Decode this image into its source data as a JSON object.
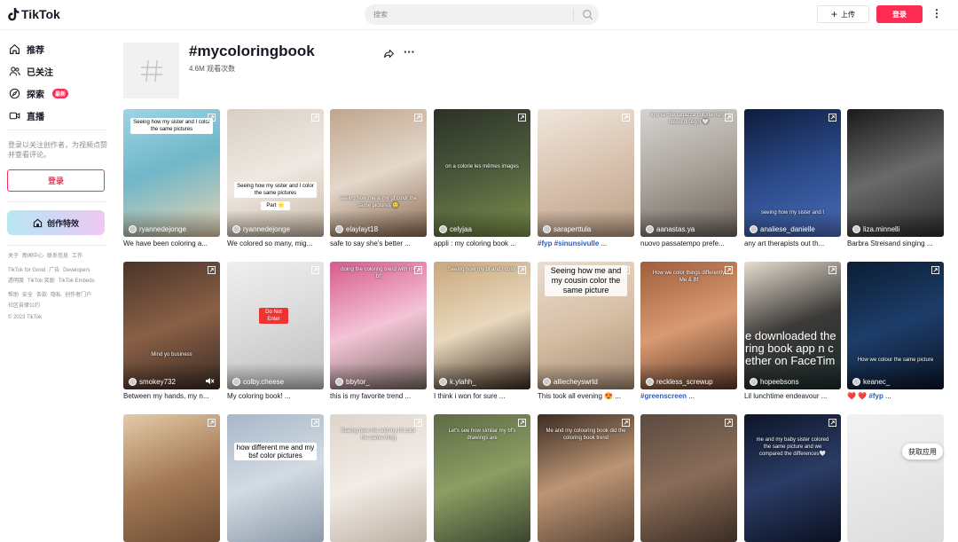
{
  "app": {
    "logo_text": "TikTok"
  },
  "search": {
    "placeholder": "搜索"
  },
  "header": {
    "upload_label": "上传",
    "login_label": "登录"
  },
  "sidebar": {
    "items": [
      {
        "label": "推荐"
      },
      {
        "label": "已关注"
      },
      {
        "label": "探索",
        "badge": "最新"
      },
      {
        "label": "直播"
      }
    ],
    "login_hint": "登录以关注创作者，为视频点赞并查看评论。",
    "login_label": "登录",
    "effects_label": "创作特效",
    "footer": [
      [
        "关于",
        "新闻中心",
        "联系信息",
        "工作"
      ],
      [
        "TikTok for Good",
        "广告",
        "Developers"
      ],
      [
        "透明度",
        "TikTok 奖励",
        "TikTok Embeds"
      ],
      [
        "帮助",
        "安全",
        "条款",
        "隐私",
        "创作者门户"
      ],
      [
        "社区自律公约"
      ],
      [
        "© 2023 TikTok"
      ]
    ]
  },
  "tag": {
    "title": "#mycoloringbook",
    "views": "4.6M 观看次数"
  },
  "videos": [
    {
      "author": "ryannedejonge",
      "caption": "We have been coloring a...",
      "overlay": "Seeing how my sister and I color the same pictures"
    },
    {
      "author": "ryannedejonge",
      "caption": "We colored so many, mig...",
      "overlay": "Seeing how my sister and I color the same pictures",
      "overlay2": "Part 🌟"
    },
    {
      "author": "elaylayt18",
      "caption": "safe to say she's better ...",
      "overlay": "seeing how me & my gf color the same pictures 🙂"
    },
    {
      "author": "celyjaa",
      "caption": "appli : my coloring book ...",
      "overlay": "on a colorie les mêmes images"
    },
    {
      "author": "saraperttula",
      "caption_tag": "#fyp #sinunsivulle",
      "caption": " ...",
      "overlay": ""
    },
    {
      "author": "aanastas.ya",
      "caption": "nuovo passatempo prefe...",
      "overlay": "io e la mia ragazza coloriamo gli stessi disegni 🤍"
    },
    {
      "author": "analiese_danielle",
      "caption": "any art therapists out th...",
      "overlay": "seeing how my sister and I"
    },
    {
      "author": "liza.minnelli",
      "caption": "Barbra Streisand singing ...",
      "overlay": ""
    },
    {
      "author": "smokey732",
      "caption": "Between my hands, my n...",
      "overlay": "Mind yo business"
    },
    {
      "author": "colby.cheese",
      "caption": "My coloring book! ...",
      "overlay": "Do Not Enter"
    },
    {
      "author": "bbytor_",
      "caption": "this is my favorite trend ...",
      "overlay": "doing the coloring trend with my bf"
    },
    {
      "author": "k.ylahh_",
      "caption": "I think i won for sure ...",
      "overlay": "Seeing how my bf and I color"
    },
    {
      "author": "alliecheyswrld",
      "caption": "This took all evening 😍 ...",
      "overlay": "Seeing how me and my cousin color the same picture"
    },
    {
      "author": "reckless_screwup",
      "caption_tag": "#greenscreen",
      "caption": " ...",
      "overlay": "How we color things differently Me & Bf"
    },
    {
      "author": "hopeebsons",
      "caption": "Lil lunchtime endeavour ...",
      "overlay": "e downloaded the ring book app n c ether on FaceTim"
    },
    {
      "author": "keanec_",
      "caption_tag": "#fyp",
      "caption": " ...",
      "caption_prefix": "❤️ ❤️ ",
      "overlay": "How we colour the same picture"
    },
    {
      "overlay": ""
    },
    {
      "overlay": "how different me and my bsf color pictures"
    },
    {
      "overlay": "Seeing how me and my bf color the same thing"
    },
    {
      "overlay": "Let's see how similar my bf's drawings are"
    },
    {
      "overlay": "Me and my colouring book did the coloring book trend"
    },
    {
      "overlay": ""
    },
    {
      "overlay": "me and my baby sister colored the same picture and we compared the differences🤍"
    },
    {
      "overlay": ""
    }
  ],
  "get_app_label": "获取应用",
  "colors": {
    "brand": "#fe2c55",
    "hashtag": "#2b5db9"
  }
}
